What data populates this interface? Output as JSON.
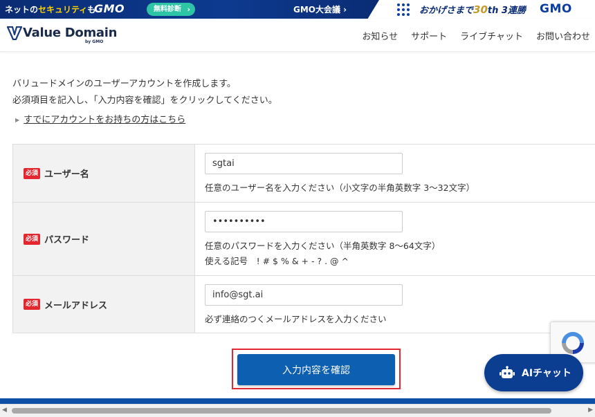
{
  "gmo_bar": {
    "net_prefix": "ネットの",
    "net_security": "セキュリティ",
    "net_suffix": "も",
    "logo_left": "GMO",
    "diagnosis_label": "無料診断",
    "conference_label": "GMO大会議 ›",
    "okage_prefix": "おかげさまで",
    "okage_number": "30",
    "okage_suffix": "th 3連勝",
    "logo_right": "GMO"
  },
  "header": {
    "brand_name": "Value Domain",
    "brand_by": "by GMO",
    "nav": [
      "お知らせ",
      "サポート",
      "ライブチャット",
      "お問い合わせ"
    ]
  },
  "intro": {
    "line1": "バリュードメインのユーザーアカウントを作成します。",
    "line2": "必須項目を記入し、「入力内容を確認」をクリックしてください。",
    "login_link": "すでにアカウントをお持ちの方はこちら"
  },
  "form": {
    "required_badge": "必須",
    "username": {
      "label": "ユーザー名",
      "value": "sgtai",
      "hint": "任意のユーザー名を入力ください（小文字の半角英数字 3〜32文字）"
    },
    "password": {
      "label": "パスワード",
      "value": "••••••••••",
      "hint": "任意のパスワードを入力ください（半角英数字 8〜64文字）",
      "hint2": "使える記号　! # $ % & + - ? . @ ^"
    },
    "email": {
      "label": "メールアドレス",
      "value": "info@sgt.ai",
      "hint": "必ず連絡のつくメールアドレスを入力ください"
    }
  },
  "submit_label": "入力内容を確認",
  "ai_chat_label": "AIチャット",
  "colors": {
    "primary": "#0d5fb2",
    "required": "#e4262f",
    "gmo_navy": "#0b2c74"
  }
}
